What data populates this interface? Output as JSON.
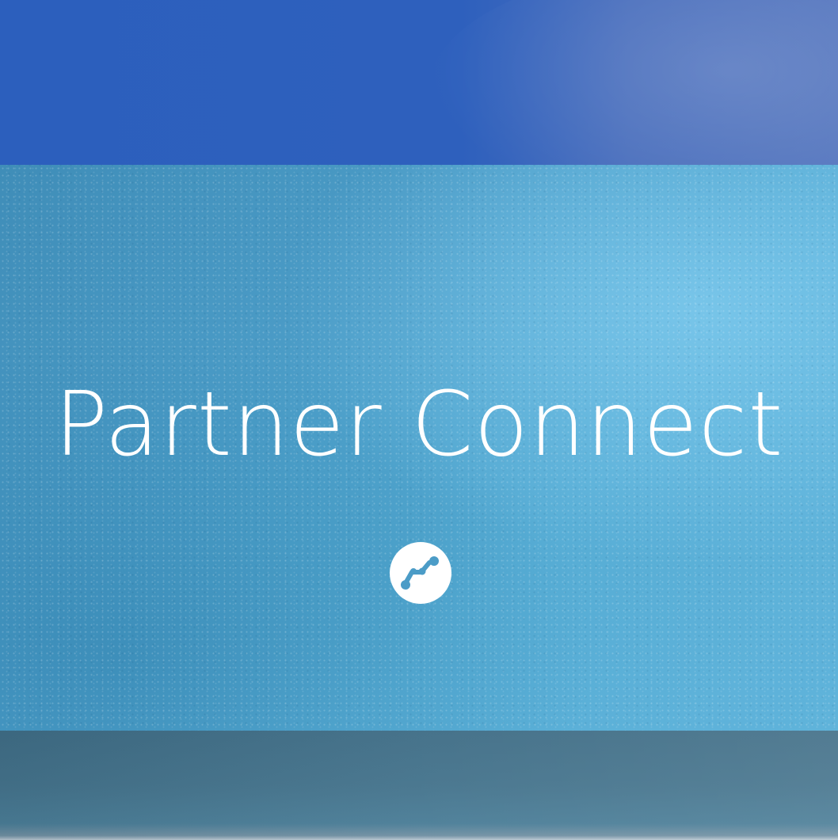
{
  "hero": {
    "title": "Partner Connect",
    "logo_icon": "partner-connect-logo-icon"
  },
  "colors": {
    "top_band": "#2e60bd",
    "hero_light": "#5fb3da",
    "hero_dark": "#3f8db8",
    "bottom_band": "#44738c",
    "text": "#ffffff",
    "logo_mark": "#4b9cc7"
  }
}
